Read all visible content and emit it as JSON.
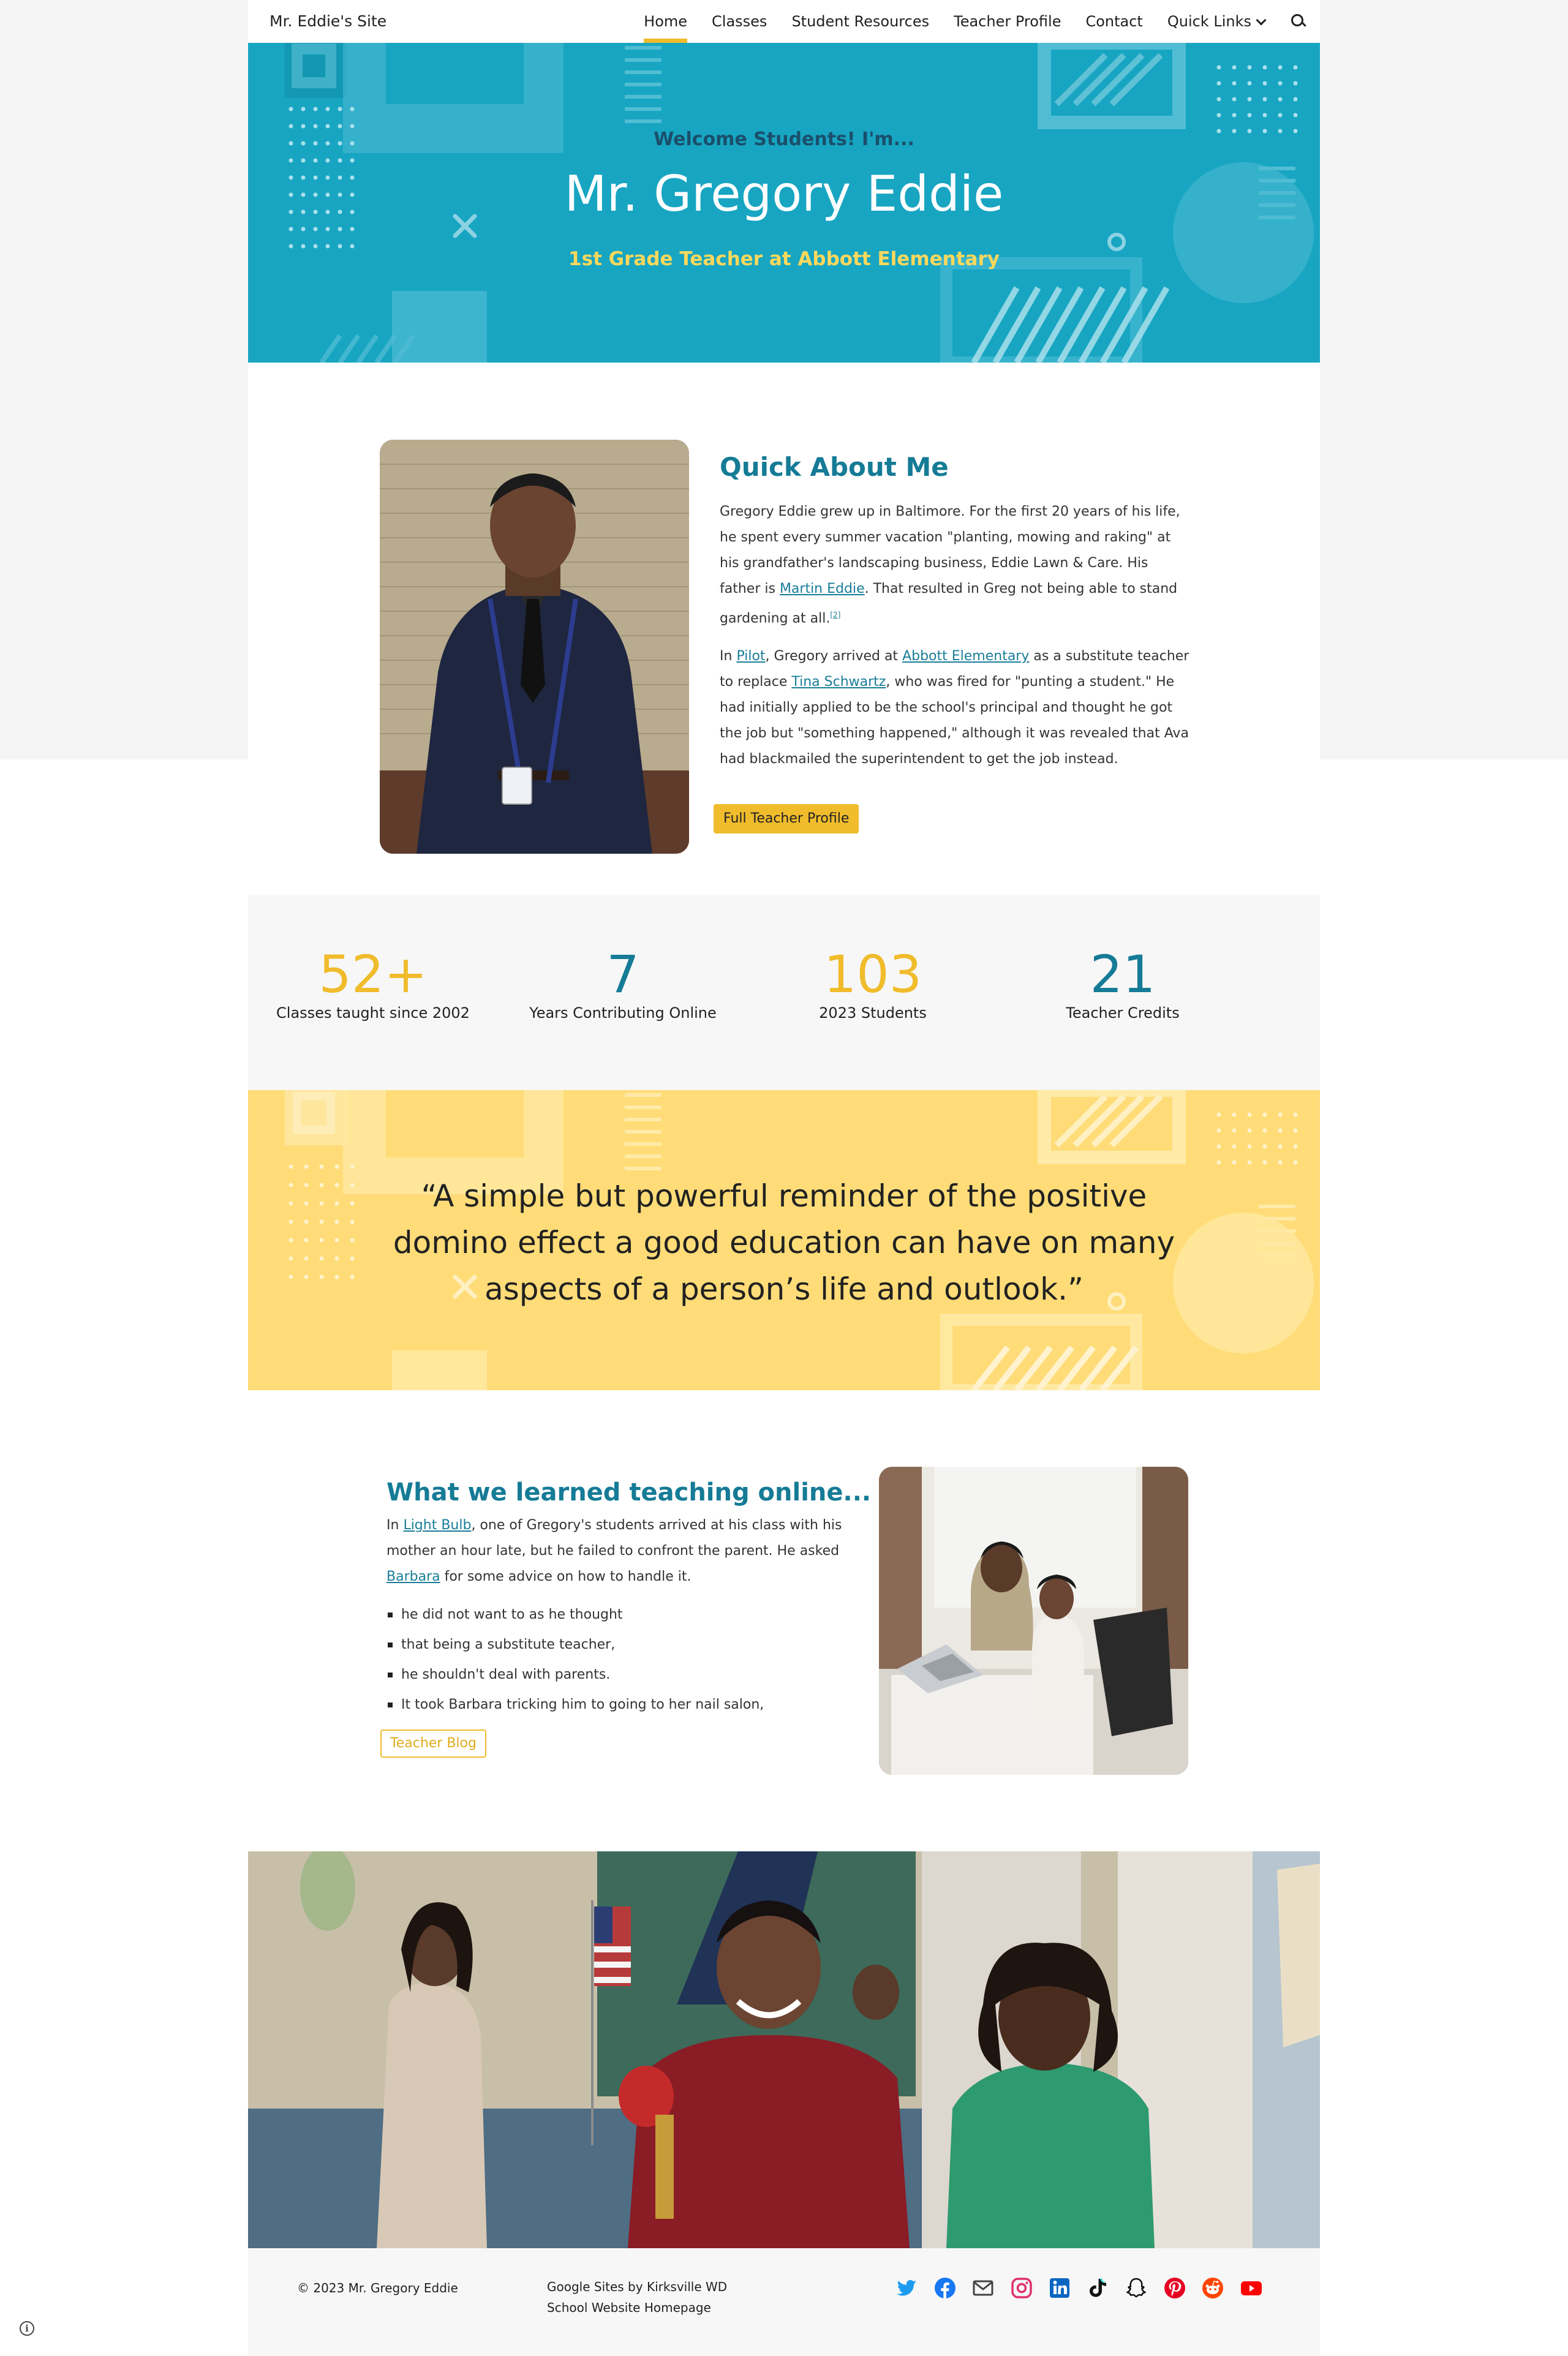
{
  "nav": {
    "site_title": "Mr. Eddie's Site",
    "items": [
      {
        "label": "Home",
        "active": true
      },
      {
        "label": "Classes"
      },
      {
        "label": "Student Resources"
      },
      {
        "label": "Teacher Profile"
      },
      {
        "label": "Contact"
      },
      {
        "label": "Quick Links"
      }
    ],
    "search_icon": "search-icon"
  },
  "hero": {
    "kicker": "Welcome Students! I'm...",
    "title": "Mr. Gregory Eddie",
    "subtitle": "1st Grade Teacher at Abbott Elementary",
    "bg_color": "#17a5c2",
    "kicker_color": "#1a4f6b",
    "subtitle_color": "#fbd85c"
  },
  "about": {
    "title": "Quick About Me",
    "p1_a": "Gregory Eddie grew up in Baltimore. For the first 20 years of his life, he spent every summer vacation \"planting, mowing and raking\" at his grandfather's landscaping business, Eddie Lawn & Care. His father is ",
    "p1_link": "Martin Eddie",
    "p1_b": ". That resulted in Greg not being able to stand gardening at all.",
    "p1_ref": "[2]",
    "p2_a": "In ",
    "p2_link1": "Pilot",
    "p2_b": ", Gregory arrived at ",
    "p2_link2": "Abbott Elementary",
    "p2_c": " as a substitute teacher to replace ",
    "p2_link3": "Tina Schwartz",
    "p2_d": ", who was fired for \"punting a student.\" He had initially applied to be the school's principal and thought he got the job but \"something happened,\" although it was revealed that Ava had blackmailed the superintendent to get the job instead.",
    "button": "Full Teacher Profile"
  },
  "stats": [
    {
      "value": "52+",
      "label": "Classes taught since 2002",
      "color": "#f0bc2c"
    },
    {
      "value": "7",
      "label": "Years Contributing Online",
      "color": "#157b96"
    },
    {
      "value": "103",
      "label": "2023 Students",
      "color": "#f0bc2c"
    },
    {
      "value": "21",
      "label": "Teacher Credits",
      "color": "#157b96"
    }
  ],
  "quote": {
    "text": "“A simple but powerful reminder of the positive domino effect a good education can have on many aspects of a person’s life and outlook.”",
    "bg_color": "#ffdc78"
  },
  "learned": {
    "title": "What we learned teaching online...",
    "t_a": "In ",
    "t_link1": "Light Bulb",
    "t_b": ", one of Gregory's students arrived at his class with his mother an hour late, but he failed to confront the parent. He asked ",
    "t_link2": "Barbara",
    "t_c": " for some advice on how to handle it.",
    "bullets": [
      "he did not want to as he thought",
      "that being a substitute teacher,",
      "he shouldn't deal with parents.",
      "It took Barbara tricking him to going to her nail salon,"
    ],
    "button": "Teacher Blog"
  },
  "footer": {
    "copyright": "© 2023 Mr. Gregory Eddie",
    "credit": "Google Sites by Kirksville WD",
    "homepage": "School Website Homepage",
    "socials": [
      "twitter-icon",
      "facebook-icon",
      "email-icon",
      "instagram-icon",
      "linkedin-icon",
      "tiktok-icon",
      "snapchat-icon",
      "pinterest-icon",
      "reddit-icon",
      "youtube-icon"
    ]
  }
}
